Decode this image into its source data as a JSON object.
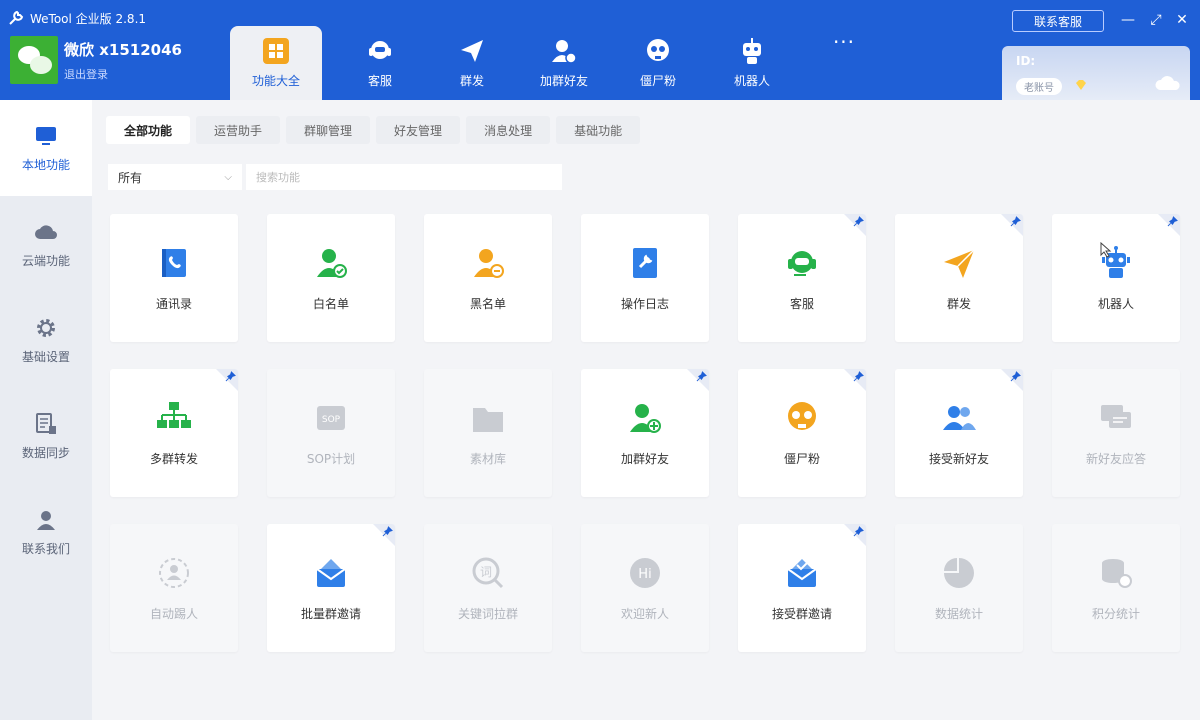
{
  "app": {
    "title": "WeTool 企业版 2.8.1"
  },
  "account": {
    "name": "微欣 x1512046",
    "logout": "退出登录"
  },
  "top_tabs": [
    {
      "label": "功能大全",
      "icon": "grid-icon"
    },
    {
      "label": "客服",
      "icon": "headset-icon"
    },
    {
      "label": "群发",
      "icon": "send-icon"
    },
    {
      "label": "加群好友",
      "icon": "add-friend-icon"
    },
    {
      "label": "僵尸粉",
      "icon": "skull-icon"
    },
    {
      "label": "机器人",
      "icon": "robot-icon"
    }
  ],
  "more_label": "···",
  "header": {
    "contact_label": "联系客服",
    "id_label": "ID:",
    "user_badge": "老账号"
  },
  "sidebar": {
    "items": [
      {
        "label": "本地功能",
        "icon": "monitor-icon"
      },
      {
        "label": "云端功能",
        "icon": "cloud-icon"
      },
      {
        "label": "基础设置",
        "icon": "gear-icon"
      },
      {
        "label": "数据同步",
        "icon": "sync-doc-icon"
      },
      {
        "label": "联系我们",
        "icon": "user-icon"
      }
    ]
  },
  "sub_tabs": [
    "全部功能",
    "运营助手",
    "群聊管理",
    "好友管理",
    "消息处理",
    "基础功能"
  ],
  "filter": {
    "selected": "所有",
    "search_placeholder": "搜索功能"
  },
  "cards": [
    {
      "label": "通讯录",
      "icon": "contacts-icon",
      "enabled": true,
      "pinned": false
    },
    {
      "label": "白名单",
      "icon": "whitelist-user-icon",
      "enabled": true,
      "pinned": false
    },
    {
      "label": "黑名单",
      "icon": "blacklist-user-icon",
      "enabled": true,
      "pinned": false
    },
    {
      "label": "操作日志",
      "icon": "log-icon",
      "enabled": true,
      "pinned": false
    },
    {
      "label": "客服",
      "icon": "headset-icon",
      "enabled": true,
      "pinned": true
    },
    {
      "label": "群发",
      "icon": "send-icon",
      "enabled": true,
      "pinned": true
    },
    {
      "label": "机器人",
      "icon": "robot-icon",
      "enabled": true,
      "pinned": true
    },
    {
      "label": "多群转发",
      "icon": "org-tree-icon",
      "enabled": true,
      "pinned": true
    },
    {
      "label": "SOP计划",
      "icon": "sop-icon",
      "enabled": false,
      "pinned": false
    },
    {
      "label": "素材库",
      "icon": "folder-icon",
      "enabled": false,
      "pinned": false
    },
    {
      "label": "加群好友",
      "icon": "add-friend-icon",
      "enabled": true,
      "pinned": true
    },
    {
      "label": "僵尸粉",
      "icon": "skull-icon",
      "enabled": true,
      "pinned": true
    },
    {
      "label": "接受新好友",
      "icon": "users-icon",
      "enabled": true,
      "pinned": true
    },
    {
      "label": "新好友应答",
      "icon": "chat-icon",
      "enabled": false,
      "pinned": false
    },
    {
      "label": "自动踢人",
      "icon": "kick-user-icon",
      "enabled": false,
      "pinned": false
    },
    {
      "label": "批量群邀请",
      "icon": "mail-invite-icon",
      "enabled": true,
      "pinned": true
    },
    {
      "label": "关键词拉群",
      "icon": "keyword-icon",
      "enabled": false,
      "pinned": false
    },
    {
      "label": "欢迎新人",
      "icon": "hi-icon",
      "enabled": false,
      "pinned": false
    },
    {
      "label": "接受群邀请",
      "icon": "mail-accept-icon",
      "enabled": true,
      "pinned": true
    },
    {
      "label": "数据统计",
      "icon": "pie-chart-icon",
      "enabled": false,
      "pinned": false
    },
    {
      "label": "积分统计",
      "icon": "coins-icon",
      "enabled": false,
      "pinned": false
    }
  ],
  "colors": {
    "brand_blue": "#1f5fd6",
    "green": "#26b24a",
    "orange": "#f3a51f",
    "blue": "#2f7fe8",
    "disabled": "#c9ccd2"
  }
}
